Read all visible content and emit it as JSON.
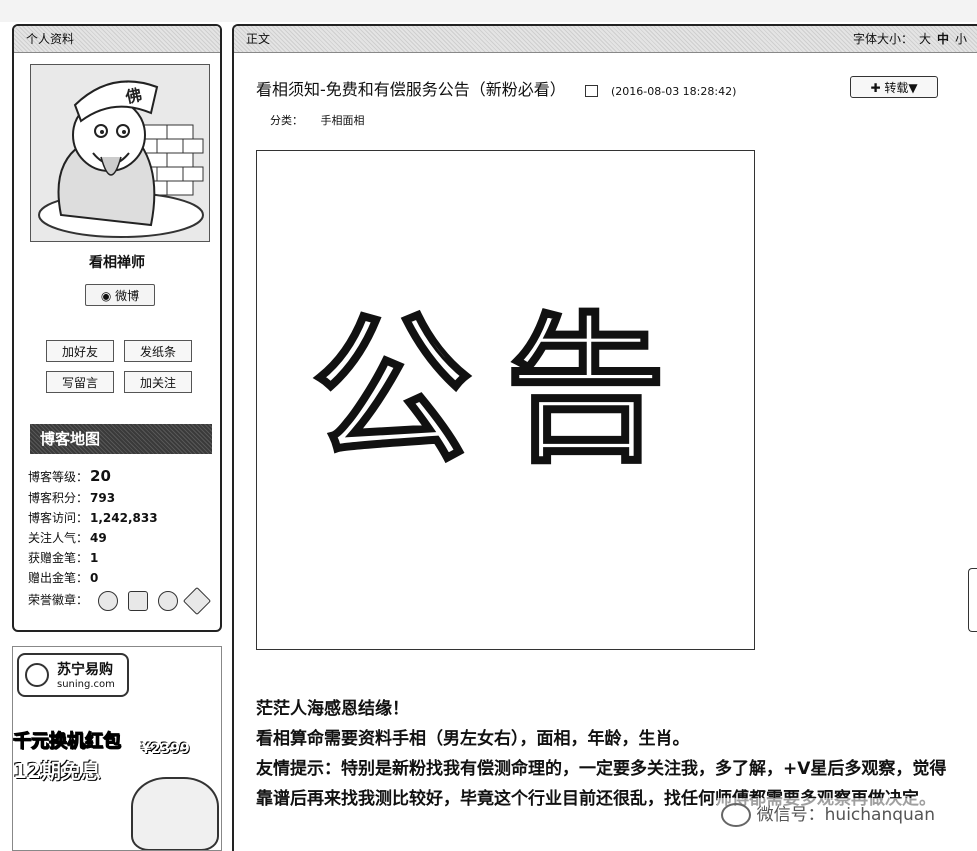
{
  "profile": {
    "header": "个人资料",
    "nickname": "看相禅师",
    "weibo_label": "微博",
    "actions": [
      "加好友",
      "发纸条",
      "写留言",
      "加关注"
    ],
    "banner_label": "博客地图",
    "stats": [
      {
        "label": "博客等级：",
        "value": "20"
      },
      {
        "label": "博客积分：",
        "value": "793"
      },
      {
        "label": "博客访问：",
        "value": "1,242,833"
      },
      {
        "label": "关注人气：",
        "value": "49"
      },
      {
        "label": "获赠金笔：",
        "value": "1"
      },
      {
        "label": "赠出金笔：",
        "value": "0"
      },
      {
        "label": "荣誉徽章：",
        "value": ""
      }
    ],
    "honor_icons": [
      "medal-icon",
      "camera-icon",
      "badge-icon",
      "pen-icon"
    ]
  },
  "ad": {
    "brand_cn": "苏宁易购",
    "brand_en": "suning.com",
    "line1": "千元换机红包",
    "line2": "12期免息",
    "price": "¥2399"
  },
  "article": {
    "section_header": "正文",
    "font_size_label": "字体大小：",
    "font_sizes": [
      "大",
      "中",
      "小"
    ],
    "title": "看相须知-免费和有偿服务公告（新粉必看）",
    "timestamp": "(2016-08-03 18:28:42)",
    "reprint_label": "转载▼",
    "category_label": "分类：",
    "category_value": "手相面相",
    "image_text": "公告",
    "paragraphs": [
      "茫茫人海感恩结缘！",
      "看相算命需要资料手相（男左女右），面相，年龄，生肖。",
      "友情提示：特别是新粉找我有偿测命理的，一定要多关注我，多了解，+V星后多观察，觉得靠谱后再来找我测比较好，毕竟这个行业目前还很乱，找任何师傅都需要多观察再做决定。"
    ]
  },
  "watermark": "微信号：huichanquan"
}
